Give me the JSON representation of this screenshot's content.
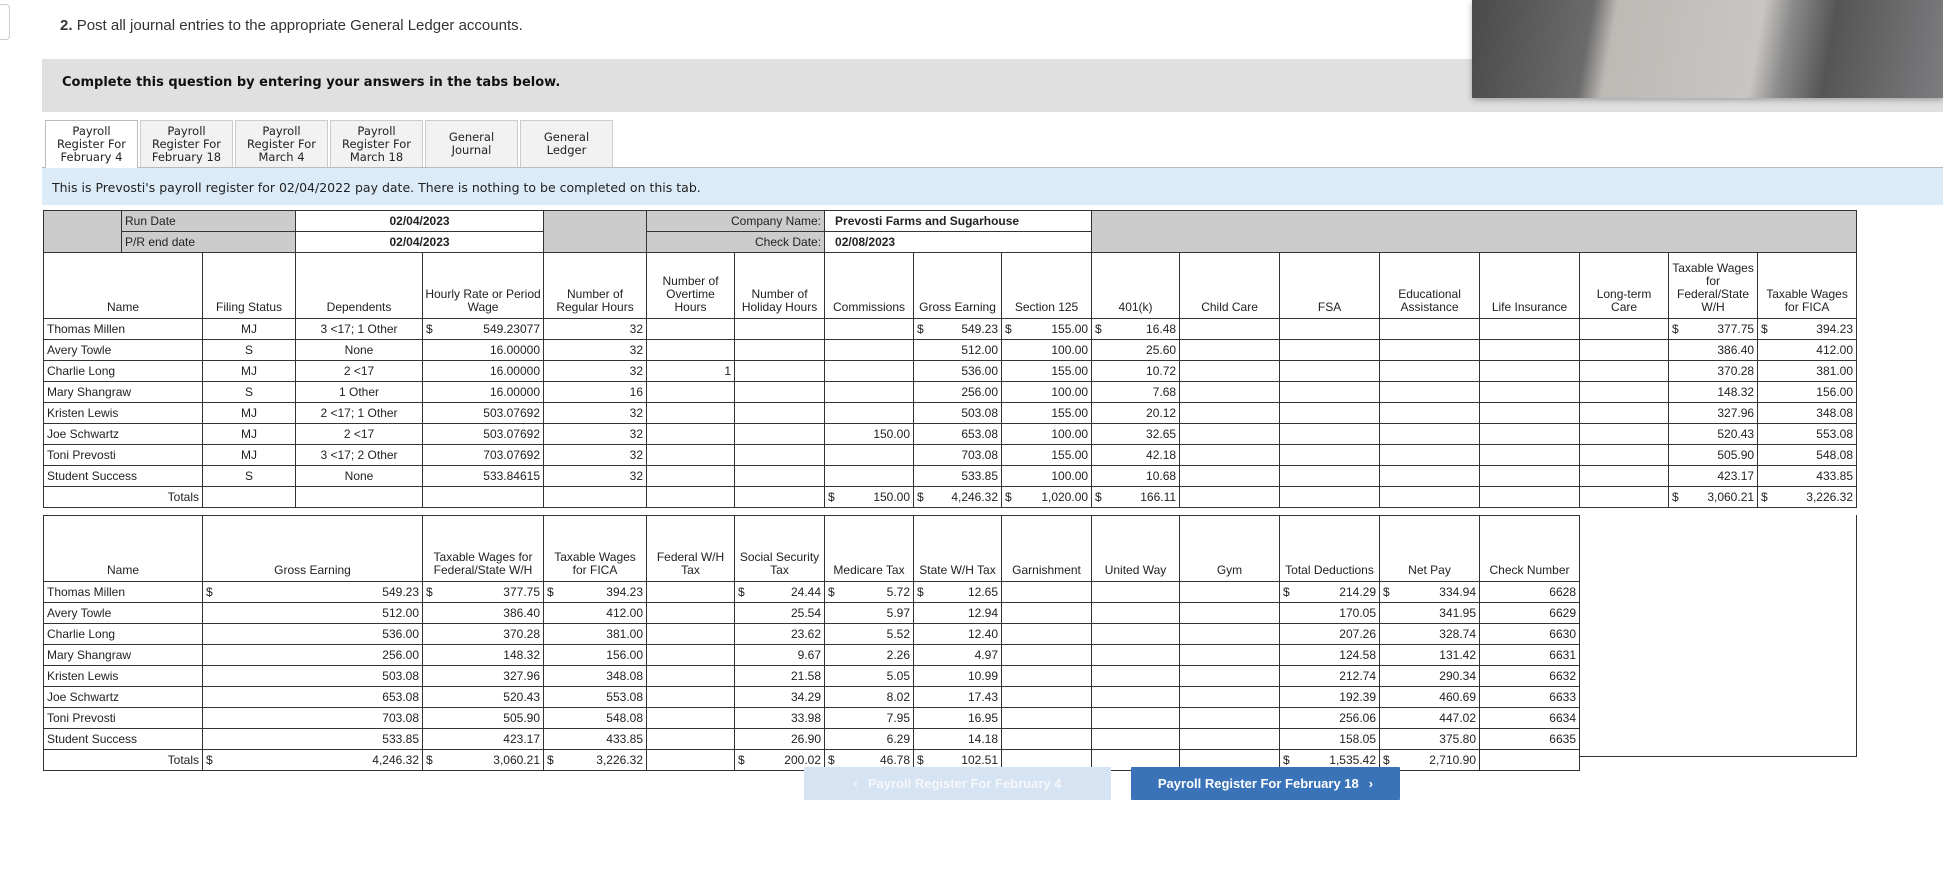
{
  "question": {
    "number": "2.",
    "text": "Post all journal entries to the appropriate General Ledger accounts."
  },
  "banner": "Complete this question by entering your answers in the tabs below.",
  "tabs": [
    {
      "label": "Payroll Register For February 4",
      "active": true
    },
    {
      "label": "Payroll Register For February 18"
    },
    {
      "label": "Payroll Register For March 4"
    },
    {
      "label": "Payroll Register For March 18"
    },
    {
      "label": "General Journal"
    },
    {
      "label": "General Ledger"
    }
  ],
  "info": "This is Prevosti's payroll register for 02/04/2022 pay date. There is nothing to be completed on this tab.",
  "meta": {
    "run_date_label": "Run Date",
    "run_date": "02/04/2023",
    "pr_end_label": "P/R end date",
    "pr_end": "02/04/2023",
    "company_label": "Company Name:",
    "company": "Prevosti Farms and Sugarhouse",
    "check_date_label": "Check Date:",
    "check_date": "02/08/2023"
  },
  "currency_symbol": "$",
  "top": {
    "headers": [
      "Name",
      "Filing Status",
      "Dependents",
      "Hourly Rate or Period Wage",
      "Number of Regular Hours",
      "Number of Overtime Hours",
      "Number of Holiday Hours",
      "Commissions",
      "Gross Earning",
      "Section 125",
      "401(k)",
      "Child Care",
      "FSA",
      "Educational Assistance",
      "Life Insurance",
      "Long-term Care",
      "Taxable Wages for Federal/State W/H",
      "Taxable Wages for FICA"
    ],
    "rows": [
      [
        "Thomas Millen",
        "MJ",
        "3 <17; 1 Other",
        "549.23077",
        "32",
        "",
        "",
        "",
        "549.23",
        "155.00",
        "16.48",
        "",
        "",
        "",
        "",
        "",
        "377.75",
        "394.23"
      ],
      [
        "Avery Towle",
        "S",
        "None",
        "16.00000",
        "32",
        "",
        "",
        "",
        "512.00",
        "100.00",
        "25.60",
        "",
        "",
        "",
        "",
        "",
        "386.40",
        "412.00"
      ],
      [
        "Charlie Long",
        "MJ",
        "2 <17",
        "16.00000",
        "32",
        "1",
        "",
        "",
        "536.00",
        "155.00",
        "10.72",
        "",
        "",
        "",
        "",
        "",
        "370.28",
        "381.00"
      ],
      [
        "Mary Shangraw",
        "S",
        "1 Other",
        "16.00000",
        "16",
        "",
        "",
        "",
        "256.00",
        "100.00",
        "7.68",
        "",
        "",
        "",
        "",
        "",
        "148.32",
        "156.00"
      ],
      [
        "Kristen Lewis",
        "MJ",
        "2 <17; 1 Other",
        "503.07692",
        "32",
        "",
        "",
        "",
        "503.08",
        "155.00",
        "20.12",
        "",
        "",
        "",
        "",
        "",
        "327.96",
        "348.08"
      ],
      [
        "Joe Schwartz",
        "MJ",
        "2 <17",
        "503.07692",
        "32",
        "",
        "",
        "150.00",
        "653.08",
        "100.00",
        "32.65",
        "",
        "",
        "",
        "",
        "",
        "520.43",
        "553.08"
      ],
      [
        "Toni Prevosti",
        "MJ",
        "3 <17; 2 Other",
        "703.07692",
        "32",
        "",
        "",
        "",
        "703.08",
        "155.00",
        "42.18",
        "",
        "",
        "",
        "",
        "",
        "505.90",
        "548.08"
      ],
      [
        "Student Success",
        "S",
        "None",
        "533.84615",
        "32",
        "",
        "",
        "",
        "533.85",
        "100.00",
        "10.68",
        "",
        "",
        "",
        "",
        "",
        "423.17",
        "433.85"
      ]
    ],
    "totals_label": "Totals",
    "totals": [
      "",
      "",
      "",
      "",
      "",
      "",
      "",
      "150.00",
      "4,246.32",
      "1,020.00",
      "166.11",
      "",
      "",
      "",
      "",
      "",
      "3,060.21",
      "3,226.32"
    ]
  },
  "bottom": {
    "headers": [
      "Name",
      "Gross Earning",
      "Taxable Wages for Federal/State W/H",
      "Taxable Wages for FICA",
      "Federal W/H Tax",
      "Social Security Tax",
      "Medicare Tax",
      "State W/H Tax",
      "Garnishment",
      "United Way",
      "Gym",
      "Total Deductions",
      "Net Pay",
      "Check Number"
    ],
    "rows": [
      [
        "Thomas Millen",
        "549.23",
        "377.75",
        "394.23",
        "",
        "24.44",
        "5.72",
        "12.65",
        "",
        "",
        "",
        "214.29",
        "334.94",
        "6628"
      ],
      [
        "Avery Towle",
        "512.00",
        "386.40",
        "412.00",
        "",
        "25.54",
        "5.97",
        "12.94",
        "",
        "",
        "",
        "170.05",
        "341.95",
        "6629"
      ],
      [
        "Charlie Long",
        "536.00",
        "370.28",
        "381.00",
        "",
        "23.62",
        "5.52",
        "12.40",
        "",
        "",
        "",
        "207.26",
        "328.74",
        "6630"
      ],
      [
        "Mary Shangraw",
        "256.00",
        "148.32",
        "156.00",
        "",
        "9.67",
        "2.26",
        "4.97",
        "",
        "",
        "",
        "124.58",
        "131.42",
        "6631"
      ],
      [
        "Kristen Lewis",
        "503.08",
        "327.96",
        "348.08",
        "",
        "21.58",
        "5.05",
        "10.99",
        "",
        "",
        "",
        "212.74",
        "290.34",
        "6632"
      ],
      [
        "Joe Schwartz",
        "653.08",
        "520.43",
        "553.08",
        "",
        "34.29",
        "8.02",
        "17.43",
        "",
        "",
        "",
        "192.39",
        "460.69",
        "6633"
      ],
      [
        "Toni Prevosti",
        "703.08",
        "505.90",
        "548.08",
        "",
        "33.98",
        "7.95",
        "16.95",
        "",
        "",
        "",
        "256.06",
        "447.02",
        "6634"
      ],
      [
        "Student Success",
        "533.85",
        "423.17",
        "433.85",
        "",
        "26.90",
        "6.29",
        "14.18",
        "",
        "",
        "",
        "158.05",
        "375.80",
        "6635"
      ]
    ],
    "totals_label": "Totals",
    "totals": [
      "",
      "4,246.32",
      "3,060.21",
      "3,226.32",
      "",
      "200.02",
      "46.78",
      "102.51",
      "",
      "",
      "",
      "1,535.42",
      "2,710.90",
      ""
    ]
  },
  "nav": {
    "prev": "Payroll Register For February 4",
    "next": "Payroll Register For February 18",
    "prev_enabled": false
  }
}
